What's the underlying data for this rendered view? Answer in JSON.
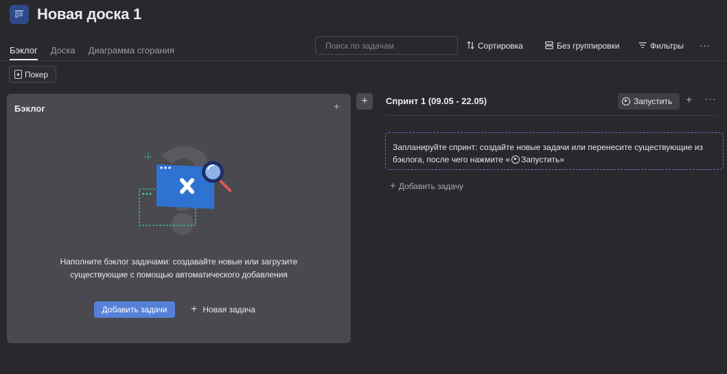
{
  "board": {
    "title": "Новая доска 1"
  },
  "tabs": [
    {
      "label": "Бэклог"
    },
    {
      "label": "Доска"
    },
    {
      "label": "Диаграмма сгорания"
    }
  ],
  "toolbar": {
    "search_placeholder": "Поиск по задачам",
    "sort_label": "Сортировка",
    "group_label": "Без группировки",
    "filter_label": "Фильтры",
    "more_label": "···"
  },
  "poker": {
    "label": "Покер"
  },
  "backlog": {
    "title": "Бэклог",
    "plus": "+",
    "empty_text": "Наполните бэклог задачами: создавайте новые или загрузите существующие с помощью автоматического добавления",
    "add_tasks_label": "Добавить задачи",
    "new_task_label": "Новая задача"
  },
  "sprint": {
    "add_plus": "+",
    "title": "Спринт 1 (09.05 - 22.05)",
    "start_label": "Запустить",
    "plus": "+",
    "more": "···",
    "plan_text_before": "Запланируйте спринт: создайте новые задачи или перенесите существующие из бэклога, после чего нажмите «",
    "plan_text_start": "Запустить",
    "plan_text_after": "»",
    "add_task_label": "Добавить задачу"
  },
  "colors": {
    "background": "#29282d",
    "panel": "#4a494f",
    "accent": "#5680d8",
    "dashed_border": "#5f77b8",
    "board_icon": "#2f4a86"
  },
  "icons": {
    "board": "board-icon",
    "sort": "sort-arrows-icon",
    "group": "rows-icon",
    "filter": "filter-icon",
    "poker": "poker-card-icon",
    "play": "play-circle-icon",
    "illustration": "empty-backlog-illustration"
  }
}
